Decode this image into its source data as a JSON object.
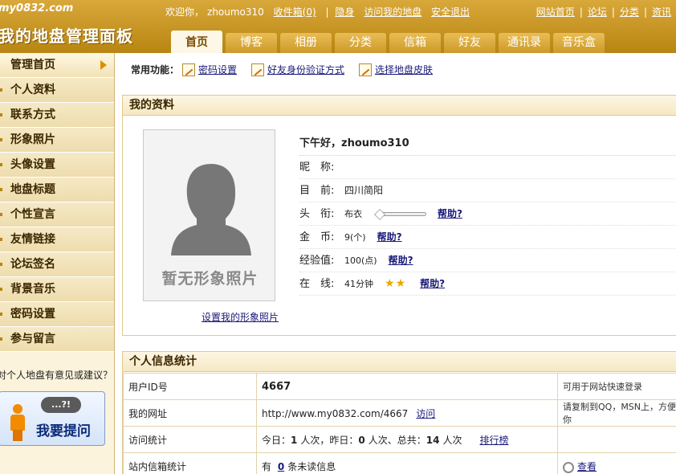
{
  "header": {
    "site": "my0832.com",
    "panel_title": "我的地盘管理面板",
    "welcome": "欢迎你，",
    "username": "zhoumo310",
    "inbox": "收件箱(0)",
    "hide": "隐身",
    "visit": "访问我的地盘",
    "logout": "安全退出",
    "top_links": [
      "网站首页",
      "论坛",
      "分类",
      "资讯"
    ],
    "tabs": [
      "首页",
      "博客",
      "相册",
      "分类",
      "信箱",
      "好友",
      "通讯录",
      "音乐盒"
    ]
  },
  "sidebar": {
    "items": [
      "管理首页",
      "个人资料",
      "联系方式",
      "形象照片",
      "头像设置",
      "地盘标题",
      "个性宣言",
      "友情链接",
      "论坛签名",
      "背景音乐",
      "密码设置",
      "参与留言"
    ],
    "feedback": "对个人地盘有意见或建议？",
    "ask_bubble": "...?!",
    "ask_label": "我要提问"
  },
  "quick": {
    "label": "常用功能：",
    "links": [
      "密码设置",
      "好友身份验证方式",
      "选择地盘皮肤"
    ]
  },
  "profile": {
    "title": "我的资料",
    "photo_placeholder": "暂无形象照片",
    "set_photo": "设置我的形象照片",
    "greeting": "下午好，",
    "name": "zhoumo310",
    "rows": {
      "nickname_label": "昵　称:",
      "location_label": "目　前:",
      "location_value": "四川简阳",
      "rank_label": "头　衔:",
      "rank_value": "布衣",
      "coins_label": "金　币:",
      "coins_value": "9(个)",
      "exp_label": "经验值:",
      "exp_value": "100(点)",
      "online_label": "在　线:",
      "online_value": "41分钟",
      "help": "帮助?"
    },
    "online_stars": 2
  },
  "stats": {
    "title": "个人信息统计",
    "rows": [
      {
        "label": "用户ID号",
        "value": "4667",
        "note": "可用于网站快速登录"
      },
      {
        "label": "我的网址",
        "value": "http://www.my0832.com/4667",
        "link": "访问",
        "note": "请复制到QQ，MSN上，方便你"
      },
      {
        "label": "访问统计",
        "today_pre": "今日：",
        "today": "1",
        "yesterday_pre": "人次，昨日：",
        "yesterday": "0",
        "total_pre": "人次、总共：",
        "total": "14",
        "unit": "人次",
        "link": "排行榜",
        "note": ""
      },
      {
        "label": "站内信箱统计",
        "pre": "有",
        "count": "0",
        "post": "条未读信息",
        "note_link": "查看"
      }
    ]
  }
}
